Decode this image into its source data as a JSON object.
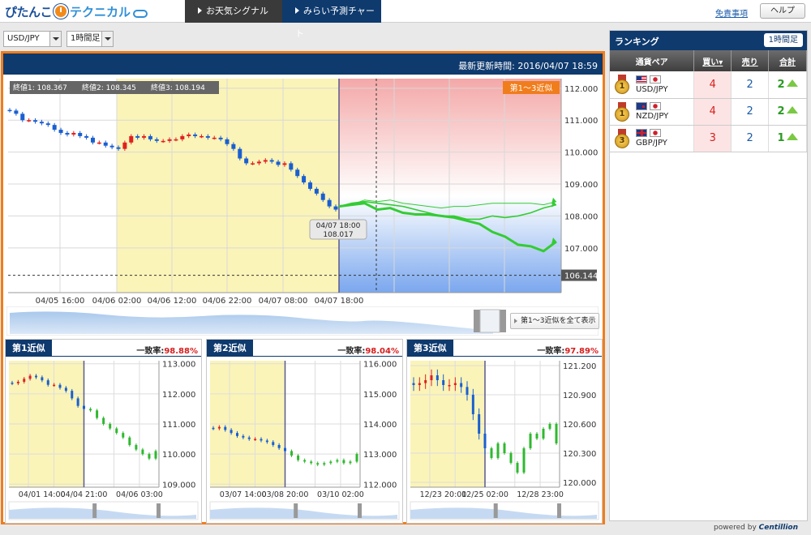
{
  "header": {
    "logo_part1": "ぴたんこ",
    "logo_part2": "テクニカル",
    "tabs": [
      {
        "label": "お天気シグナル"
      },
      {
        "label": "みらい予測チャート"
      }
    ],
    "disclaimer": "免責事項",
    "help": "ヘルプ"
  },
  "controls": {
    "pair": "USD/JPY",
    "timeframe": "1時間足"
  },
  "main": {
    "updated": "最新更新時間: 2016/04/07 18:59",
    "endvals": [
      "終値1: 108.367",
      "終値2: 108.345",
      "終値3: 108.194"
    ],
    "future_badge": "第1～3近似",
    "current_label": [
      "04/07 18:00",
      "108.017"
    ],
    "dashed_price": "106.144",
    "show_all": "第1～3近似を全て表示",
    "colors": {
      "accent": "#f07d1c",
      "header": "#0e3a6e",
      "up": "#e02020",
      "down": "#1a5fd0",
      "forecast": "#33cc33"
    }
  },
  "chart_data": [
    {
      "type": "line",
      "title": "USD/JPY 1時間足",
      "x_ticks": [
        "04/05 16:00",
        "04/06 02:00",
        "04/06 12:00",
        "04/06 22:00",
        "04/07 08:00",
        "04/07 18:00"
      ],
      "y_ticks": [
        112.0,
        111.0,
        110.0,
        109.0,
        108.0,
        107.0
      ],
      "ylim": [
        105.6,
        112.3
      ],
      "history": [
        111.3,
        111.2,
        111.0,
        111.0,
        110.95,
        110.9,
        110.85,
        110.7,
        110.6,
        110.55,
        110.6,
        110.5,
        110.45,
        110.3,
        110.3,
        110.2,
        110.15,
        110.1,
        110.3,
        110.5,
        110.45,
        110.5,
        110.4,
        110.35,
        110.35,
        110.4,
        110.4,
        110.5,
        110.55,
        110.5,
        110.5,
        110.45,
        110.45,
        110.4,
        110.25,
        110.1,
        109.8,
        109.65,
        109.65,
        109.7,
        109.75,
        109.7,
        109.6,
        109.65,
        109.45,
        109.25,
        109.05,
        108.85,
        108.7,
        108.5,
        108.3,
        108.2
      ],
      "series": [
        {
          "name": "第1近似",
          "values": [
            108.3,
            108.35,
            108.4,
            108.2,
            108.25,
            108.1,
            108.05,
            108.05,
            108.0,
            107.95,
            107.85,
            107.75,
            107.5,
            107.35,
            107.1,
            107.05,
            106.9,
            107.2
          ]
        },
        {
          "name": "第2近似",
          "values": [
            108.3,
            108.4,
            108.45,
            108.4,
            108.35,
            108.3,
            108.2,
            108.1,
            108.0,
            108.0,
            107.9,
            107.9,
            108.0,
            107.95,
            108.0,
            108.1,
            108.25,
            108.35
          ]
        },
        {
          "name": "第3近似",
          "values": [
            108.3,
            108.35,
            108.5,
            108.45,
            108.5,
            108.4,
            108.35,
            108.3,
            108.25,
            108.3,
            108.3,
            108.35,
            108.4,
            108.4,
            108.4,
            108.4,
            108.35,
            108.45
          ]
        }
      ]
    },
    {
      "type": "line",
      "title": "第1近似",
      "rate_label": "一致率:",
      "rate": "98.88%",
      "x_ticks": [
        "04/01 14:00",
        "04/04 21:00",
        "04/06 03:00"
      ],
      "y_ticks": [
        113.0,
        112.0,
        111.0,
        110.0,
        109.0
      ],
      "ylim": [
        108.9,
        113.1
      ],
      "values": [
        112.35,
        112.4,
        112.5,
        112.6,
        112.55,
        112.45,
        112.3,
        112.3,
        112.2,
        112.1,
        111.85,
        111.6,
        111.5,
        111.45,
        111.2,
        111.0,
        110.85,
        110.7,
        110.55,
        110.3,
        110.15,
        110.0,
        109.85,
        110.1
      ]
    },
    {
      "type": "line",
      "title": "第2近似",
      "rate_label": "一致率:",
      "rate": "98.04%",
      "x_ticks": [
        "03/07 14:00",
        "03/08 20:00",
        "03/10 02:00"
      ],
      "y_ticks": [
        116.0,
        115.0,
        114.0,
        113.0,
        112.0
      ],
      "ylim": [
        111.9,
        116.1
      ],
      "values": [
        113.85,
        113.9,
        113.8,
        113.7,
        113.6,
        113.55,
        113.5,
        113.5,
        113.45,
        113.4,
        113.3,
        113.2,
        113.1,
        112.95,
        112.8,
        112.75,
        112.7,
        112.65,
        112.7,
        112.75,
        112.8,
        112.7,
        112.75,
        113.0
      ]
    },
    {
      "type": "line",
      "title": "第3近似",
      "rate_label": "一致率:",
      "rate": "97.89%",
      "x_ticks": [
        "12/23 20:00",
        "12/25 02:00",
        "12/28 23:00"
      ],
      "y_ticks": [
        121.2,
        120.9,
        120.6,
        120.3,
        120.0
      ],
      "ylim": [
        119.95,
        121.25
      ],
      "values": [
        121.0,
        121.02,
        121.05,
        121.1,
        121.05,
        121.0,
        121.0,
        121.02,
        120.98,
        120.9,
        120.7,
        120.5,
        120.35,
        120.25,
        120.4,
        120.3,
        120.2,
        120.1,
        120.35,
        120.5,
        120.45,
        120.55,
        120.6,
        120.4
      ]
    }
  ],
  "ranking": {
    "title": "ランキング",
    "timeframe": "1時間足",
    "headers": [
      "通貨ペア",
      "買い▾",
      "売り",
      "合計"
    ],
    "rows": [
      {
        "rank": "1",
        "pair": "USD/JPY",
        "buy": "4",
        "sell": "2",
        "total": "2",
        "flags": [
          "us",
          "jp"
        ]
      },
      {
        "rank": "1",
        "pair": "NZD/JPY",
        "buy": "4",
        "sell": "2",
        "total": "2",
        "flags": [
          "nz",
          "jp"
        ]
      },
      {
        "rank": "3",
        "pair": "GBP/JPY",
        "buy": "3",
        "sell": "2",
        "total": "1",
        "flags": [
          "gb",
          "jp"
        ]
      }
    ]
  },
  "footer": {
    "powered": "powered by",
    "brand": "Centillion"
  }
}
